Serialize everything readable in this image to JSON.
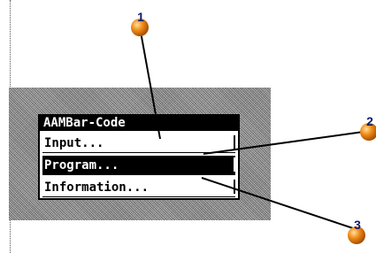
{
  "menu": {
    "title": "AAMBar-Code",
    "items": [
      {
        "label": "Input..."
      },
      {
        "label": "Program..."
      },
      {
        "label": "Information..."
      }
    ]
  },
  "callouts": [
    {
      "number": "1"
    },
    {
      "number": "2"
    },
    {
      "number": "3"
    }
  ],
  "colors": {
    "callout_ball": "#f08c1a",
    "callout_number": "#0a1a6e",
    "screen_pattern": "#9a9a9a",
    "menu_highlight": "#000000"
  }
}
